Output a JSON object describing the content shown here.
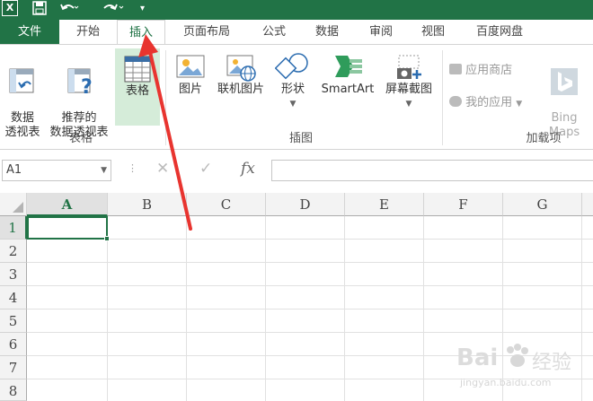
{
  "quick_access": {
    "app_icon": "X",
    "save_icon": "save-icon",
    "undo_icon": "undo-icon",
    "redo_icon": "redo-icon",
    "customize_icon": "customize-qat-icon"
  },
  "tabs": [
    {
      "label": "文件"
    },
    {
      "label": "开始"
    },
    {
      "label": "插入"
    },
    {
      "label": "页面布局"
    },
    {
      "label": "公式"
    },
    {
      "label": "数据"
    },
    {
      "label": "审阅"
    },
    {
      "label": "视图"
    },
    {
      "label": "百度网盘"
    }
  ],
  "ribbon": {
    "tables": {
      "pivot_table": "数据\n透视表",
      "recommended_pivot": "推荐的\n数据透视表",
      "table": "表格",
      "group_label": "表格"
    },
    "illustrations": {
      "pictures": "图片",
      "online_pictures": "联机图片",
      "shapes": "形状",
      "smartart": "SmartArt",
      "screenshot": "屏幕截图",
      "group_label": "插图"
    },
    "addins": {
      "store": "应用商店",
      "my_apps": "我的应用",
      "bing_maps": "Bing\nMaps",
      "group_label": "加载项"
    }
  },
  "formula_bar": {
    "name_box": "A1",
    "fx": "fx",
    "cancel": "✕",
    "enter": "✓"
  },
  "grid": {
    "columns": [
      "A",
      "B",
      "C",
      "D",
      "E",
      "F",
      "G"
    ],
    "rows": [
      "1",
      "2",
      "3",
      "4",
      "5",
      "6",
      "7",
      "8"
    ],
    "active_cell": "A1"
  },
  "watermark": {
    "text1": "Bai",
    "text2": "经验",
    "text3": "jingyan.baidu.com"
  },
  "colors": {
    "excel_green": "#217346",
    "arrow_red": "#e8342f"
  }
}
